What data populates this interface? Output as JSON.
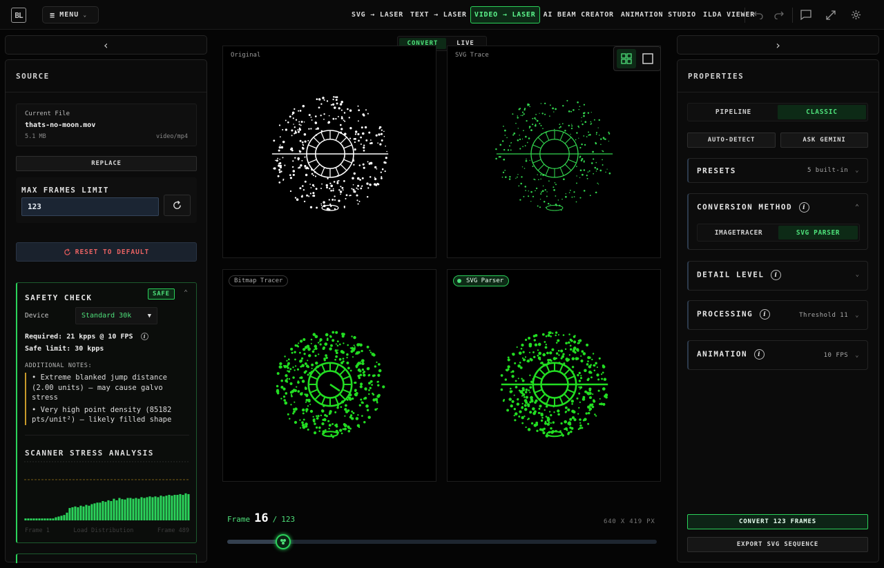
{
  "topbar": {
    "logo_text": "BL",
    "menu_label": "MENU",
    "nav": [
      {
        "label": "SVG → LASER",
        "active": false
      },
      {
        "label": "TEXT → LASER",
        "active": false
      },
      {
        "label": "VIDEO → LASER",
        "active": true
      },
      {
        "label": "AI BEAM CREATOR",
        "active": false
      },
      {
        "label": "ANIMATION STUDIO",
        "active": false
      },
      {
        "label": "ILDA VIEWER",
        "active": false
      }
    ]
  },
  "left": {
    "collapse_glyph": "‹",
    "header": "SOURCE",
    "file": {
      "caption": "Current File",
      "name": "thats-no-moon.mov",
      "size": "5.1 MB",
      "type": "video/mp4"
    },
    "replace_label": "REPLACE",
    "max_frames": {
      "label": "MAX FRAMES LIMIT",
      "value": "123"
    },
    "reset_label": "RESET TO DEFAULT",
    "safety": {
      "title": "SAFETY CHECK",
      "badge": "SAFE",
      "device_label": "Device",
      "device_value": "Standard 30k",
      "required": "Required: 21 kpps @ 10 FPS",
      "safe_limit": "Safe limit: 30 kpps",
      "notes_title": "ADDITIONAL NOTES:",
      "notes": [
        "• Extreme blanked jump distance (2.00 units) — may cause galvo stress",
        "• Very high point density (85182 pts/unit²) — likely filled shape"
      ]
    },
    "stress": {
      "title": "SCANNER STRESS ANALYSIS",
      "left_label": "Frame 1",
      "center_label": "Load Distribution",
      "right_label": "Frame 489",
      "bars": [
        0.05,
        0.05,
        0.05,
        0.05,
        0.05,
        0.05,
        0.05,
        0.05,
        0.05,
        0.05,
        0.05,
        0.08,
        0.1,
        0.12,
        0.14,
        0.2,
        0.32,
        0.34,
        0.36,
        0.34,
        0.38,
        0.36,
        0.4,
        0.38,
        0.42,
        0.44,
        0.46,
        0.46,
        0.5,
        0.48,
        0.52,
        0.5,
        0.56,
        0.52,
        0.58,
        0.55,
        0.54,
        0.58,
        0.58,
        0.56,
        0.58,
        0.56,
        0.6,
        0.58,
        0.6,
        0.62,
        0.6,
        0.62,
        0.6,
        0.64,
        0.62,
        0.64,
        0.66,
        0.64,
        0.66,
        0.66,
        0.68,
        0.66,
        0.7,
        0.68
      ]
    }
  },
  "center": {
    "modes": [
      {
        "label": "CONVERT",
        "active": true
      },
      {
        "label": "LIVE",
        "active": false
      }
    ],
    "quadrants": [
      {
        "label": "Original",
        "style": "plain",
        "color": "#ffffff"
      },
      {
        "label": "SVG Trace",
        "style": "plain",
        "color": "#33d64f"
      },
      {
        "label": "Bitmap Tracer",
        "style": "pill",
        "color": "#22dd22"
      },
      {
        "label": "SVG Parser",
        "style": "pill-active",
        "color": "#22dd22"
      }
    ],
    "frame": {
      "label": "Frame",
      "current": "16",
      "sep": "/",
      "total": "123",
      "progress": 0.13
    },
    "resolution": "640 X 419 PX"
  },
  "right": {
    "collapse_glyph": "›",
    "header": "PROPERTIES",
    "engine_tabs": [
      {
        "label": "PIPELINE",
        "active": false
      },
      {
        "label": "CLASSIC",
        "active": true
      }
    ],
    "auto_detect_label": "AUTO-DETECT",
    "ask_gemini_label": "ASK GEMINI",
    "presets": {
      "title": "PRESETS",
      "value": "5 built-in"
    },
    "conversion": {
      "title": "CONVERSION METHOD",
      "options": [
        {
          "label": "IMAGETRACER",
          "active": false
        },
        {
          "label": "SVG PARSER",
          "active": true
        }
      ]
    },
    "detail": {
      "title": "DETAIL LEVEL"
    },
    "processing": {
      "title": "PROCESSING",
      "value": "Threshold 11"
    },
    "animation": {
      "title": "ANIMATION",
      "value": "10 FPS"
    },
    "convert_label": "CONVERT 123 FRAMES",
    "export_label": "EXPORT SVG SEQUENCE"
  },
  "colors": {
    "accent": "#2bd35b",
    "accent_dark": "#0d2a16",
    "warning": "#c79a2a"
  },
  "icons": [
    "menu-icon",
    "undo-icon",
    "redo-icon",
    "chat-icon",
    "expand-icon",
    "gear-icon",
    "grid-view-icon",
    "single-view-icon",
    "refresh-icon",
    "info-icon",
    "chevron-icon"
  ]
}
